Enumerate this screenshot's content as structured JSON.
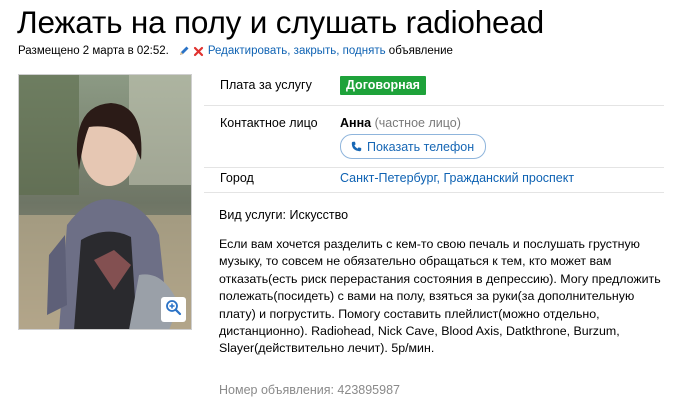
{
  "listing": {
    "title": "Лежать на полу и слушать radiohead",
    "posted": "Размещено 2 марта в 02:52.",
    "actions_link": "Редактировать, закрыть, поднять",
    "actions_suffix": " объявление"
  },
  "details": {
    "price_label": "Плата за услугу",
    "price_value": "Договорная",
    "contact_label": "Контактное лицо",
    "contact_name": "Анна",
    "contact_type": " (частное лицо)",
    "phone_button": "Показать телефон",
    "city_label": "Город",
    "city_value": "Санкт-Петербург, Гражданский проспект"
  },
  "service": "Вид услуги: Искусство",
  "description_lines": [
    "Если вам хочется разделить с кем-то свою печаль и послушать грустную",
    "музыку, то совсем не обязательно обращаться к тем, кто может вам",
    "отказать(есть риск перерастания состояния в депрессию). Могу предложить",
    "полежать(посидеть) с вами на полу, взяться за руки(за дополнительную",
    "плату) и погрустить. Помогу составить плейлист(можно отдельно,",
    "дистанционно). Radiohead, Nick Cave, Blood Axis, Datkthrone, Burzum,",
    "Slayer(действительно лечит). 5р/мин."
  ],
  "ad_number": "Номер объявления: 423895987",
  "icons": {
    "edit": "pencil-icon",
    "delete": "close-icon",
    "phone": "phone-icon",
    "zoom": "magnifier-plus-icon"
  },
  "colors": {
    "link": "#0e62b3",
    "price_badge": "#1ea23a",
    "muted": "#8a8a8a"
  }
}
